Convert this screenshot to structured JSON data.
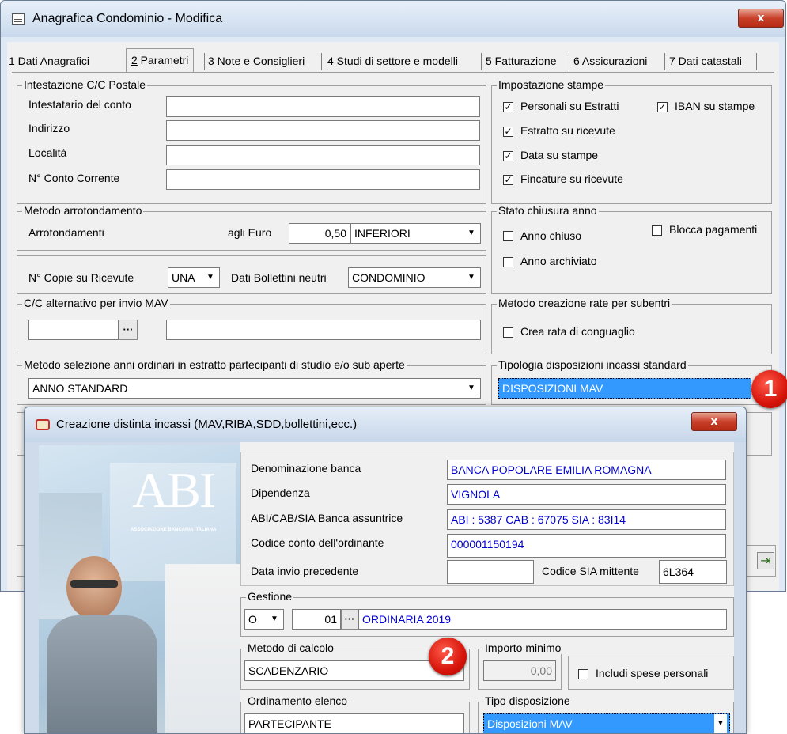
{
  "main_window": {
    "title": "Anagrafica Condominio - Modifica",
    "close_label": "x",
    "tabs": [
      {
        "key": "1",
        "label": " Dati Anagrafici"
      },
      {
        "key": "2",
        "label": " Parametri"
      },
      {
        "key": "3",
        "label": " Note e Consiglieri"
      },
      {
        "key": "4",
        "label": " Studi di settore e modelli"
      },
      {
        "key": "5",
        "label": " Fatturazione"
      },
      {
        "key": "6",
        "label": " Assicurazioni"
      },
      {
        "key": "7",
        "label": " Dati catastali"
      }
    ],
    "postale": {
      "title": "Intestazione C/C Postale",
      "intestatario": "Intestatario del conto",
      "indirizzo": "Indirizzo",
      "localita": "Località",
      "conto": "N° Conto Corrente"
    },
    "stampe": {
      "title": "Impostazione stampe",
      "personali": "Personali su Estratti",
      "iban": "IBAN su stampe",
      "estratto": "Estratto su ricevute",
      "data": "Data su stampe",
      "fincature": "Fincature su ricevute",
      "checked": [
        true,
        true,
        true,
        true,
        true
      ]
    },
    "arrotondamento": {
      "title": "Metodo arrotondamento",
      "label": "Arrotondamenti",
      "euro_label": "agli Euro",
      "euro_value": "0,50",
      "mode": "INFERIORI"
    },
    "chiusura": {
      "title": "Stato chiusura anno",
      "anno_chiuso": "Anno chiuso",
      "blocca": "Blocca pagamenti",
      "archiviato": "Anno archiviato"
    },
    "copie": {
      "label": "N° Copie su Ricevute",
      "value": "UNA",
      "bollettini_label": "Dati Bollettini neutri",
      "bollettini_value": "CONDOMINIO"
    },
    "cc_mav": {
      "title": "C/C alternativo per invio MAV",
      "dots": "···"
    },
    "subentri": {
      "title": "Metodo creazione rate per subentri",
      "crea": "Crea rata di conguaglio"
    },
    "anni": {
      "title": "Metodo selezione anni ordinari in estratto partecipanti di studio e/o sub aperte",
      "value": "ANNO STANDARD"
    },
    "tipologia": {
      "title": "Tipologia disposizioni incassi standard",
      "value": "DISPOSIZIONI MAV"
    },
    "badge": "1",
    "dropdown_glyph": "▼",
    "exit_icon_glyph": "⇥"
  },
  "dialog": {
    "title": "Creazione distinta incassi (MAV,RIBA,SDD,bollettini,ecc.)",
    "close_label": "x",
    "logo": "ABI",
    "logo_sub": "ASSOCIAZIONE BANCARIA ITALIANA",
    "denominazione_label": "Denominazione banca",
    "denominazione": "BANCA POPOLARE EMILIA ROMAGNA",
    "dipendenza_label": "Dipendenza",
    "dipendenza": "VIGNOLA",
    "abi_label": "ABI/CAB/SIA Banca assuntrice",
    "abi": "ABI : 5387 CAB : 67075 SIA : 83I14",
    "codice_label": "Codice conto dell'ordinante",
    "codice": "000001150194",
    "data_label": "Data invio precedente",
    "data": "",
    "sia_label": "Codice SIA mittente",
    "sia": "6L364",
    "gestione_title": "Gestione",
    "gestione_tipo": "O",
    "gestione_num": "01",
    "gestione_desc": "ORDINARIA 2019",
    "dots": "···",
    "metodo_title": "Metodo di calcolo",
    "metodo": "SCADENZARIO",
    "importo_title": "Importo minimo",
    "importo": "0,00",
    "includi": "Includi spese personali",
    "ordinamento_title": "Ordinamento elenco",
    "ordinamento": "PARTECIPANTE",
    "tipo_title": "Tipo disposizione",
    "tipo": "Disposizioni MAV",
    "badge": "2"
  }
}
